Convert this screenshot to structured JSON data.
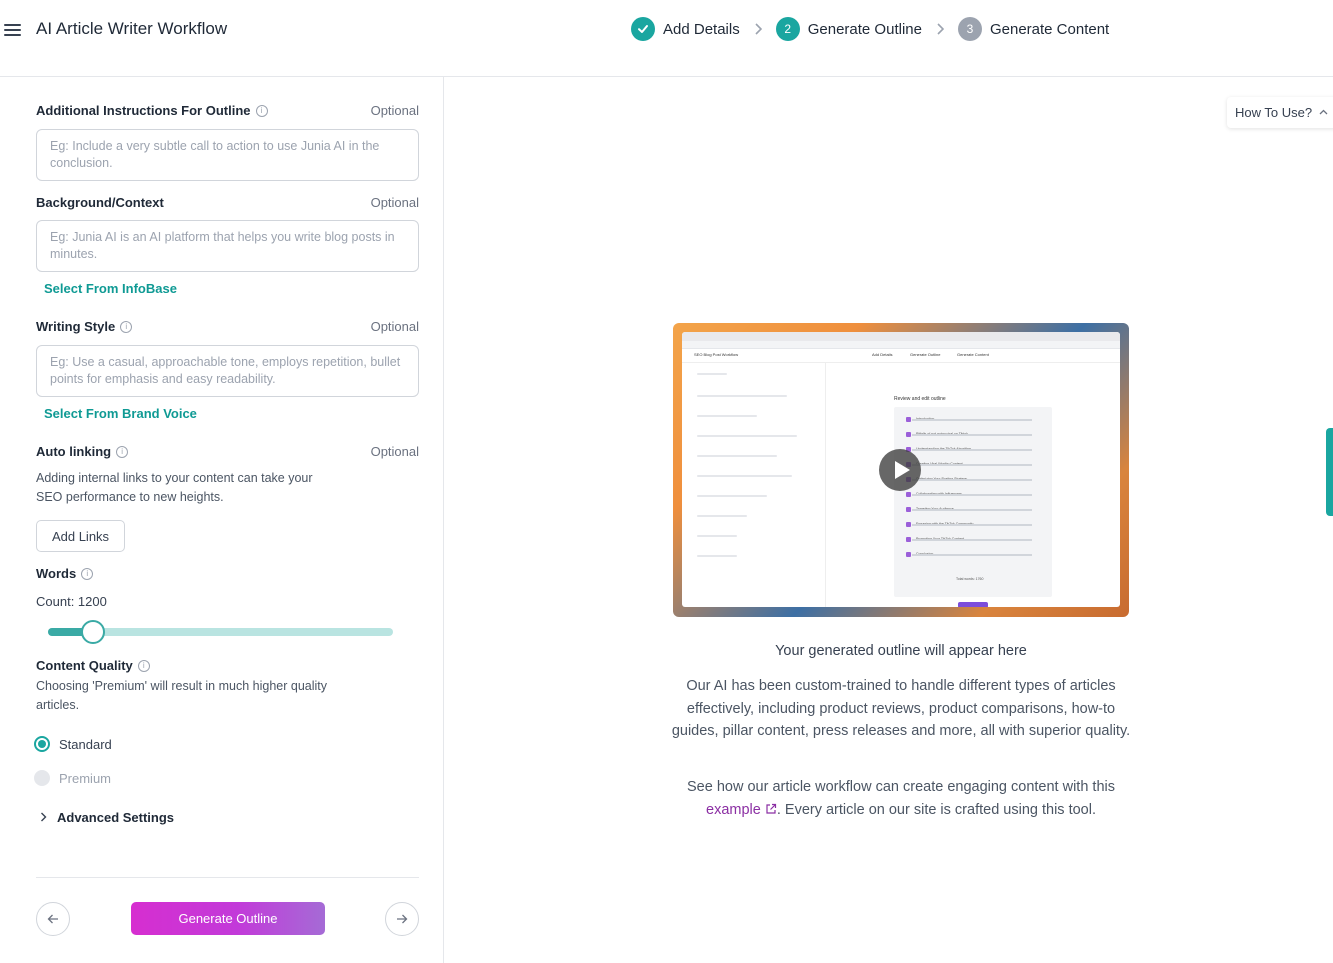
{
  "header": {
    "title": "AI Article Writer Workflow",
    "steps": [
      {
        "label": "Add Details",
        "number": "",
        "state": "done"
      },
      {
        "label": "Generate Outline",
        "number": "2",
        "state": "active"
      },
      {
        "label": "Generate Content",
        "number": "3",
        "state": "todo"
      }
    ]
  },
  "form": {
    "additional_instructions": {
      "label": "Additional Instructions For Outline",
      "optional": "Optional",
      "placeholder": "Eg: Include a very subtle call to action to use Junia AI in the conclusion."
    },
    "background": {
      "label": "Background/Context",
      "optional": "Optional",
      "placeholder": "Eg: Junia AI is an AI platform that helps you write blog posts in minutes.",
      "link": "Select From InfoBase"
    },
    "writing_style": {
      "label": "Writing Style",
      "optional": "Optional",
      "placeholder": "Eg: Use a casual, approachable tone, employs repetition, bullet points for emphasis and easy readability.",
      "link": "Select From Brand Voice"
    },
    "auto_linking": {
      "label": "Auto linking",
      "optional": "Optional",
      "description": "Adding internal links to your content can take your SEO performance to new heights.",
      "button": "Add Links"
    },
    "words": {
      "label": "Words",
      "count_text": "Count: 1200",
      "slider_fraction": 0.13
    },
    "content_quality": {
      "label": "Content Quality",
      "description": "Choosing 'Premium' will result in much higher quality articles.",
      "options": [
        {
          "label": "Standard",
          "selected": true
        },
        {
          "label": "Premium",
          "selected": false
        }
      ]
    },
    "advanced_settings": "Advanced Settings",
    "generate_button": "Generate Outline"
  },
  "right": {
    "howto_label": "How To Use?",
    "video": {
      "app_title": "SEO Blog Post Workflow",
      "steps": [
        "Add Details",
        "Generate Outline",
        "Generate Content"
      ],
      "panel_title": "Review and edit outline",
      "outline_items": [
        "Introduction",
        "Pitfalls of not going viral on Tiktok",
        "Understanding the TikTok Algorithm",
        "Creating Viral-Worthy Content",
        "Optimizing Your Posting Strategy",
        "Collaborating with Influencers",
        "Targeting Your Audience",
        "Engaging with the TikTok Community",
        "Promoting Your TikTok Content",
        "Conclusion"
      ],
      "total_words": "Total words: 1760"
    },
    "placeholder_title": "Your generated outline will appear here",
    "description": "Our AI has been custom-trained to handle different types of articles effectively, including product reviews, product comparisons, how-to guides, pillar content, press releases and more, all with superior quality.",
    "example_prefix": "See how our article workflow can create engaging content with this",
    "example_link": "example",
    "example_suffix": ". Every article on our site is crafted using this tool."
  },
  "colors": {
    "accent": "#1aa6a0",
    "button_gradient_start": "#d62ed0",
    "button_gradient_end": "#a56bd6",
    "link_purple": "#8b2fa3"
  }
}
